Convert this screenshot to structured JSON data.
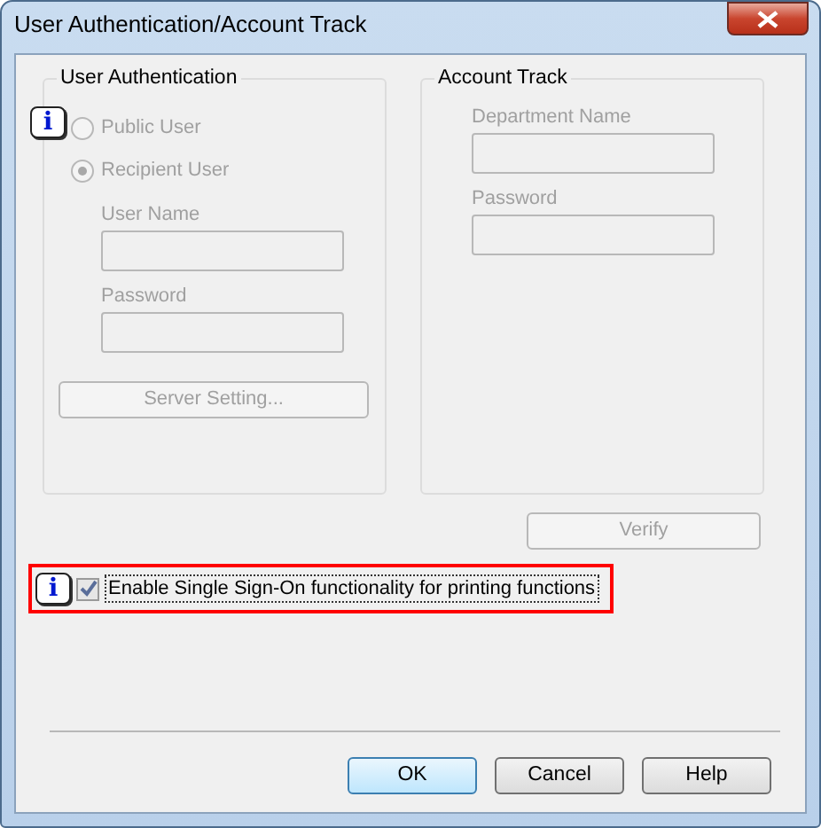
{
  "window": {
    "title": "User Authentication/Account Track"
  },
  "user_authentication": {
    "title": "User Authentication",
    "options": [
      {
        "label": "Public User",
        "selected": false,
        "disabled": true,
        "info": "i"
      },
      {
        "label": "Recipient User",
        "selected": true,
        "disabled": true
      }
    ],
    "fields": [
      {
        "label": "User Name",
        "disabled": true
      },
      {
        "label": "Password",
        "disabled": true
      }
    ],
    "button": {
      "label": "Server Setting...",
      "disabled": true
    }
  },
  "account_track": {
    "title": "Account Track",
    "fields": [
      {
        "label": "Department Name",
        "disabled": true
      },
      {
        "label": "Password",
        "disabled": true
      }
    ]
  },
  "verify_button": {
    "label": "Verify",
    "disabled": true
  },
  "single_sign_on": {
    "label": "Enable Single Sign-On functionality for printing functions",
    "checked": true,
    "highlighted": true,
    "info": "i"
  },
  "buttons": [
    {
      "label": "OK",
      "default": true
    },
    {
      "label": "Cancel",
      "default": false
    },
    {
      "label": "Help",
      "default": false
    }
  ]
}
